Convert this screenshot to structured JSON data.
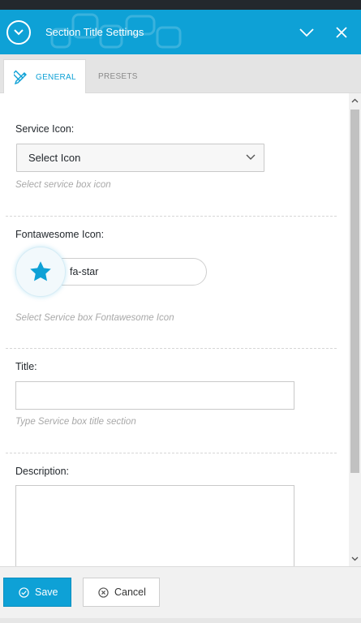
{
  "header": {
    "title": "Section Title Settings"
  },
  "tabs": [
    {
      "label": "General",
      "active": true
    },
    {
      "label": "Presets",
      "active": false
    }
  ],
  "fields": {
    "service_icon": {
      "label": "Service Icon:",
      "selected": "Select Icon",
      "description": "Select service box icon"
    },
    "fontawesome_icon": {
      "label": "Fontawesome Icon:",
      "value": "fa-star",
      "description": "Select Service box Fontawesome Icon"
    },
    "title": {
      "label": "Title:",
      "value": "",
      "description": "Type Service box title section"
    },
    "description": {
      "label": "Description:",
      "value": ""
    }
  },
  "footer": {
    "save_label": "Save",
    "cancel_label": "Cancel"
  },
  "colors": {
    "accent": "#0ea1d6",
    "header_bg": "#0ea1d6",
    "muted_text": "#a8a8a8"
  },
  "icons": [
    "chevron-down-circle-icon",
    "collapse-chevron-icon",
    "close-icon",
    "pencil-ruler-icon",
    "chevron-down-icon",
    "star-icon",
    "check-circle-icon",
    "x-circle-icon"
  ]
}
